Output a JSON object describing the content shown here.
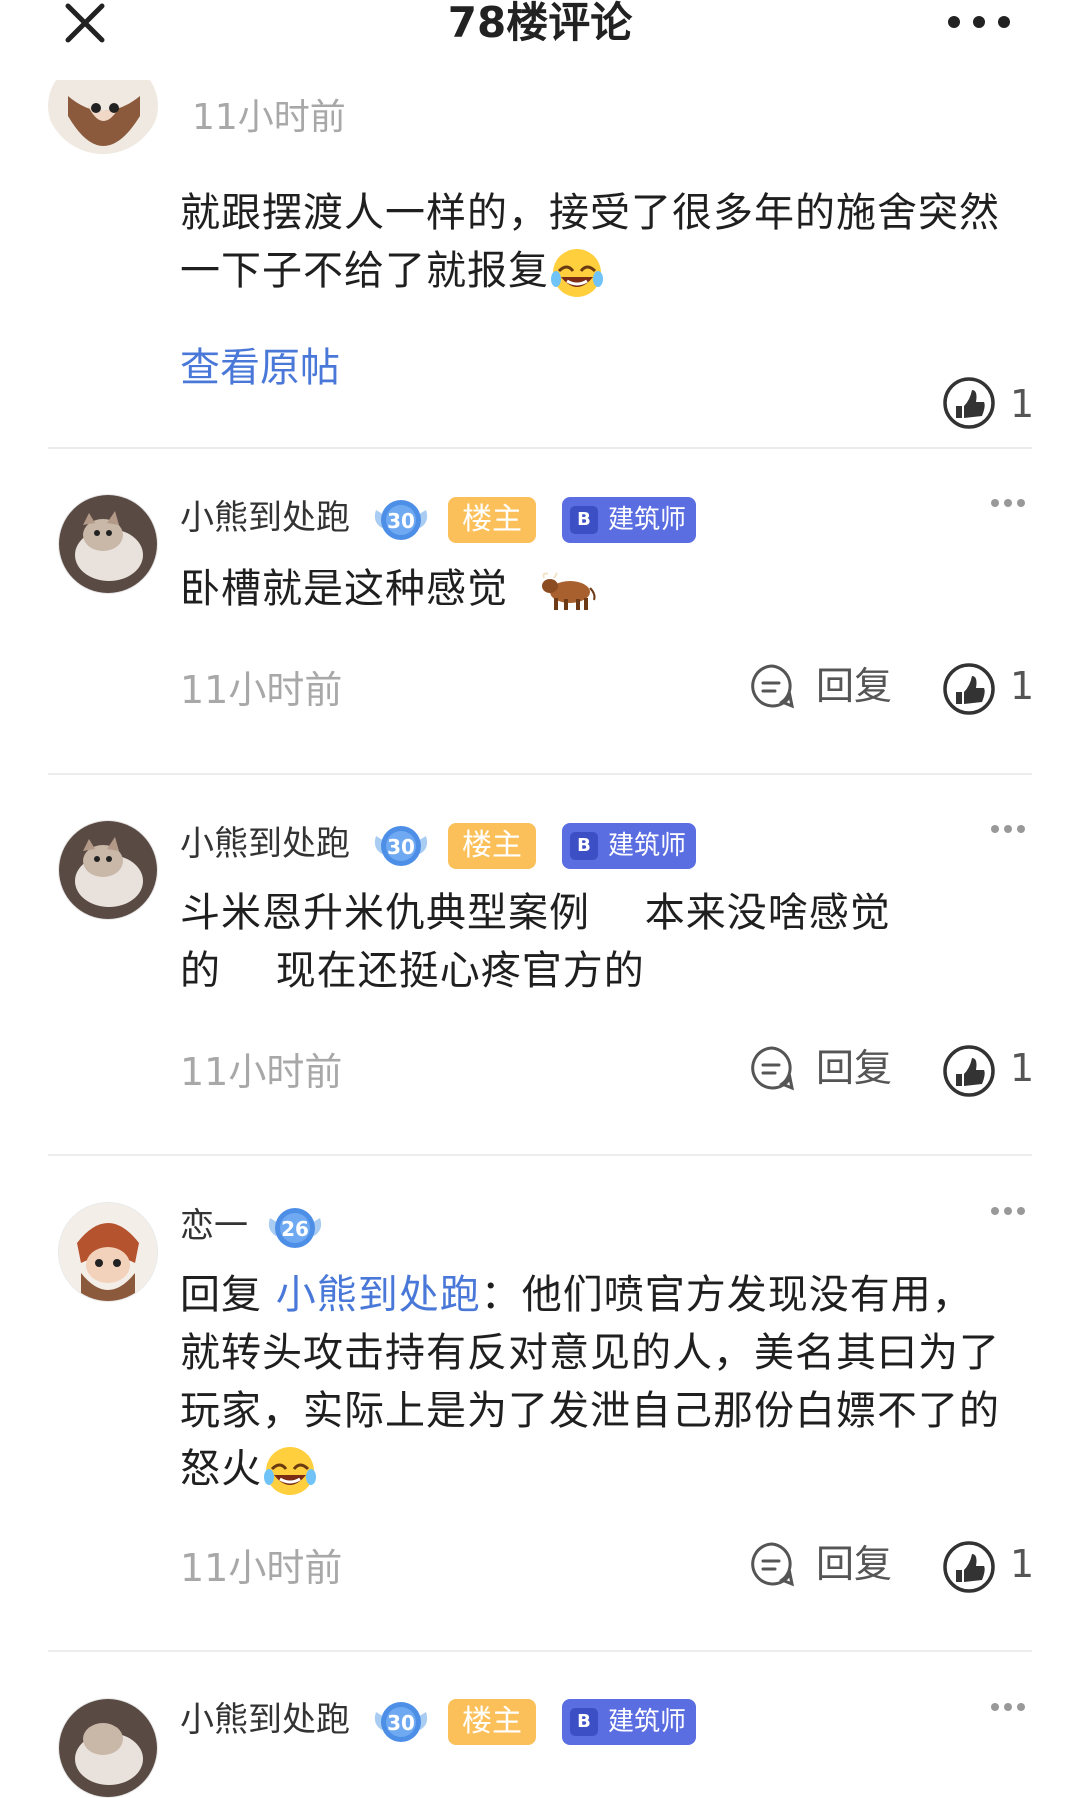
{
  "header": {
    "title": "78楼评论"
  },
  "top_comment": {
    "time": "11小时前",
    "text": "就跟摆渡人一样的，接受了很多年的施舍突然一下子不给了就报复",
    "view_original": "查看原帖",
    "likes": "1"
  },
  "comments": [
    {
      "username": "小熊到处跑",
      "level": "30",
      "badge_owner": "楼主",
      "badge_role": "建筑师",
      "text": "卧槽就是这种感觉",
      "time": "11小时前",
      "reply_label": "回复",
      "likes": "1"
    },
    {
      "username": "小熊到处跑",
      "level": "30",
      "badge_owner": "楼主",
      "badge_role": "建筑师",
      "text_line1": "斗米恩升米仇典型案例 　本来没啥感觉",
      "text_line2": "的 　现在还挺心疼官方的",
      "time": "11小时前",
      "reply_label": "回复",
      "likes": "1"
    },
    {
      "username": "恋一",
      "level": "26",
      "reply_prefix": "回复",
      "reply_to": "小熊到处跑",
      "text": "：他们喷官方发现没有用，就转头攻击持有反对意见的人，美名其曰为了玩家，实际上是为了发泄自己那份白嫖不了的怒火",
      "time": "11小时前",
      "reply_label": "回复",
      "likes": "1"
    },
    {
      "username": "小熊到处跑",
      "level": "30",
      "badge_owner": "楼主",
      "badge_role": "建筑师"
    }
  ]
}
